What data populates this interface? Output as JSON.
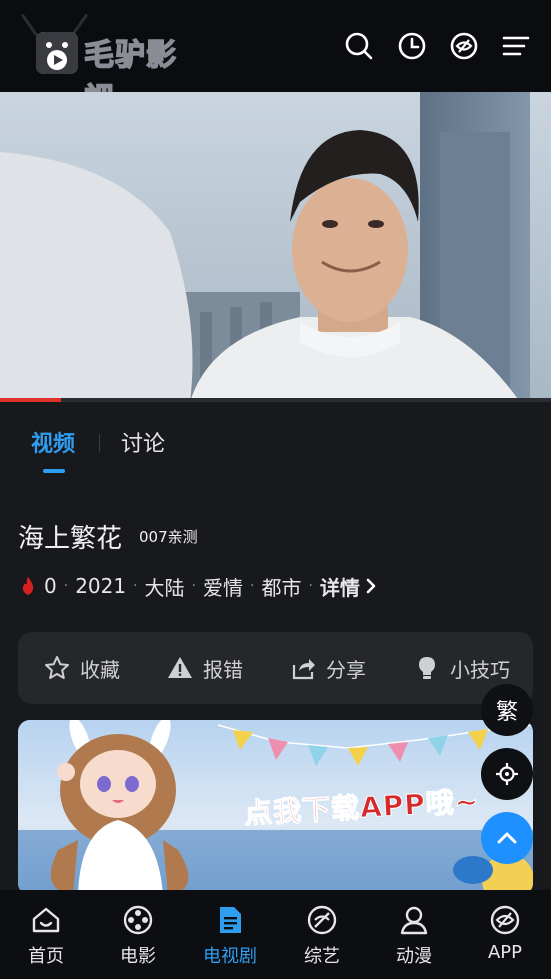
{
  "header": {
    "logo_text": "毛驴影视",
    "icons": [
      "search-icon",
      "history-icon",
      "app-icon",
      "menu-icon"
    ]
  },
  "player": {
    "progress_fraction": 0.11
  },
  "tabs": [
    {
      "label": "视频",
      "active": true
    },
    {
      "label": "讨论",
      "active": false
    }
  ],
  "show": {
    "title": "海上繁花",
    "tag": "007亲测",
    "heat": "0",
    "year": "2021",
    "region": "大陆",
    "genre1": "爱情",
    "genre2": "都市",
    "detail_label": "详情"
  },
  "actions": [
    {
      "label": "收藏",
      "icon": "star-icon"
    },
    {
      "label": "报错",
      "icon": "warning-icon"
    },
    {
      "label": "分享",
      "icon": "share-icon"
    },
    {
      "label": "小技巧",
      "icon": "lightbulb-icon"
    }
  ],
  "banner": {
    "text": "点我下载APP哦~"
  },
  "floating": {
    "traditional_label": "繁"
  },
  "bottom_nav": [
    {
      "label": "首页",
      "icon": "home-icon",
      "active": false
    },
    {
      "label": "电影",
      "icon": "film-reel-icon",
      "active": false
    },
    {
      "label": "电视剧",
      "icon": "document-icon",
      "active": true
    },
    {
      "label": "综艺",
      "icon": "variety-icon",
      "active": false
    },
    {
      "label": "动漫",
      "icon": "person-icon",
      "active": false
    },
    {
      "label": "APP",
      "icon": "app-icon",
      "active": false
    }
  ],
  "colors": {
    "accent": "#2f9df0",
    "progress": "#e0322b",
    "background": "#18191c"
  }
}
